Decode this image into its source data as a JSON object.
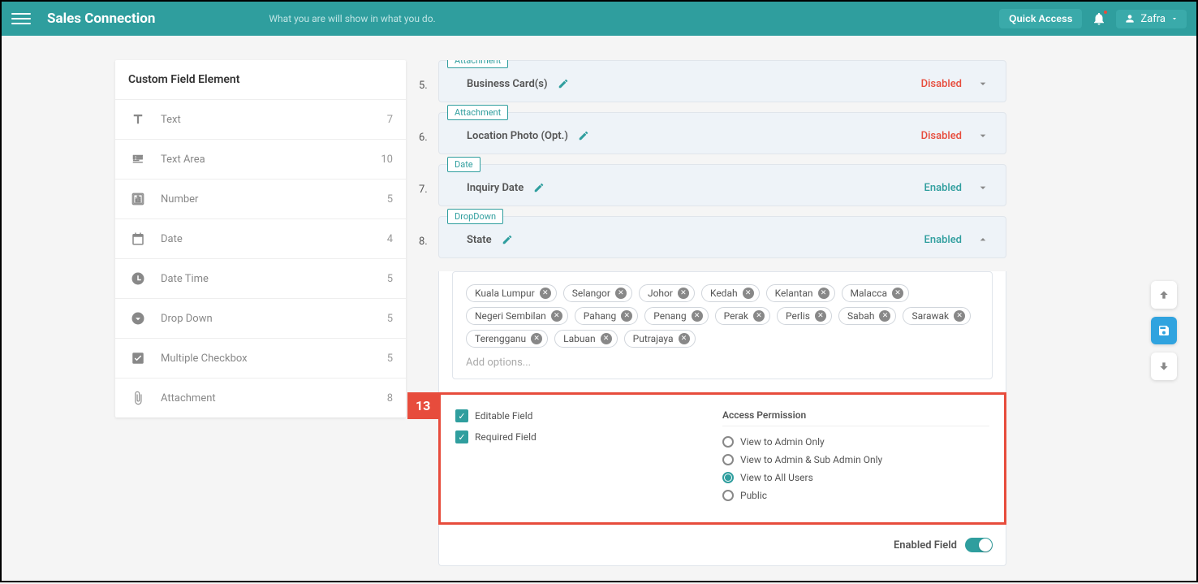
{
  "header": {
    "app_title": "Sales Connection",
    "tagline": "What you are will show in what you do.",
    "quick_access": "Quick Access",
    "user_name": "Zafra"
  },
  "sidebar": {
    "title": "Custom Field Element",
    "elements": [
      {
        "label": "Text",
        "count": "7",
        "icon": "text"
      },
      {
        "label": "Text Area",
        "count": "10",
        "icon": "textarea"
      },
      {
        "label": "Number",
        "count": "5",
        "icon": "number"
      },
      {
        "label": "Date",
        "count": "4",
        "icon": "date"
      },
      {
        "label": "Date Time",
        "count": "5",
        "icon": "datetime"
      },
      {
        "label": "Drop Down",
        "count": "5",
        "icon": "dropdown"
      },
      {
        "label": "Multiple Checkbox",
        "count": "5",
        "icon": "checkbox"
      },
      {
        "label": "Attachment",
        "count": "8",
        "icon": "attachment"
      }
    ]
  },
  "fields": [
    {
      "num": "5.",
      "chip": "Attachment",
      "title": "Business Card(s)",
      "status": "Disabled",
      "status_class": "disabled",
      "expanded": false
    },
    {
      "num": "6.",
      "chip": "Attachment",
      "title": "Location Photo (Opt.)",
      "status": "Disabled",
      "status_class": "disabled",
      "expanded": false
    },
    {
      "num": "7.",
      "chip": "Date",
      "title": "Inquiry Date",
      "status": "Enabled",
      "status_class": "enabled",
      "expanded": false
    },
    {
      "num": "8.",
      "chip": "DropDown",
      "title": "State",
      "status": "Enabled",
      "status_class": "enabled",
      "expanded": true
    }
  ],
  "dropdown_options": [
    "Kuala Lumpur",
    "Selangor",
    "Johor",
    "Kedah",
    "Kelantan",
    "Malacca",
    "Negeri Sembilan",
    "Pahang",
    "Penang",
    "Perak",
    "Perlis",
    "Sabah",
    "Sarawak",
    "Terengganu",
    "Labuan",
    "Putrajaya"
  ],
  "add_options_placeholder": "Add options...",
  "marker_number": "13",
  "settings": {
    "editable_label": "Editable Field",
    "required_label": "Required Field",
    "permission_title": "Access Permission",
    "permissions": [
      {
        "label": "View to Admin Only",
        "selected": false
      },
      {
        "label": "View to Admin & Sub Admin Only",
        "selected": false
      },
      {
        "label": "View to All Users",
        "selected": true
      },
      {
        "label": "Public",
        "selected": false
      }
    ],
    "enabled_field_label": "Enabled Field"
  }
}
